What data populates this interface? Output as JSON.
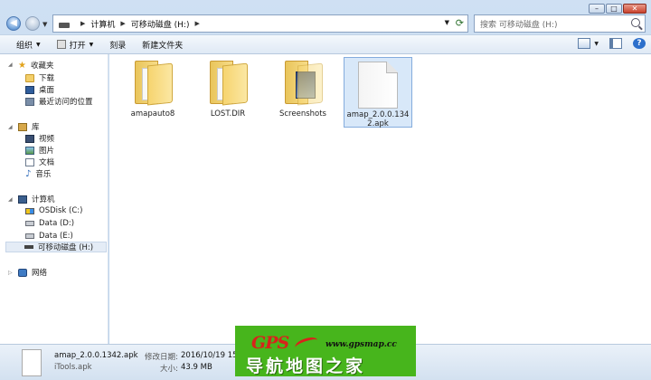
{
  "titlebar": {
    "breadcrumb": [
      "计算机",
      "可移动磁盘 (H:)"
    ],
    "search_placeholder": "搜索 可移动磁盘 (H:)",
    "controls": {
      "minimize": "–",
      "maximize": "□",
      "close": "✕"
    }
  },
  "toolbar": {
    "organize": "组织",
    "open": "打开",
    "burn": "刻录",
    "new_folder": "新建文件夹"
  },
  "sidebar": {
    "favorites": {
      "label": "收藏夹",
      "items": [
        "下载",
        "桌面",
        "最近访问的位置"
      ]
    },
    "libraries": {
      "label": "库",
      "items": [
        "视频",
        "图片",
        "文档",
        "音乐"
      ]
    },
    "computer": {
      "label": "计算机",
      "items": [
        "OSDisk (C:)",
        "Data (D:)",
        "Data (E:)",
        "可移动磁盘 (H:)"
      ]
    },
    "network": {
      "label": "网络"
    }
  },
  "files": [
    {
      "name": "amapauto8",
      "kind": "folder"
    },
    {
      "name": "LOST.DIR",
      "kind": "folder"
    },
    {
      "name": "Screenshots",
      "kind": "folder-screenshots"
    },
    {
      "name_line1": "amap_2.0.0.134",
      "name_line2": "2.apk",
      "kind": "file",
      "selected": true
    }
  ],
  "details": {
    "name": "amap_2.0.0.1342.apk",
    "type": "iTools.apk",
    "modified_label": "修改日期:",
    "modified_value": "2016/10/19 15",
    "size_label": "大小:",
    "size_value": "43.9 MB"
  },
  "watermark": {
    "logo": "GPS",
    "url": "www.gpsmap.cc",
    "text": "导航地图之家"
  }
}
